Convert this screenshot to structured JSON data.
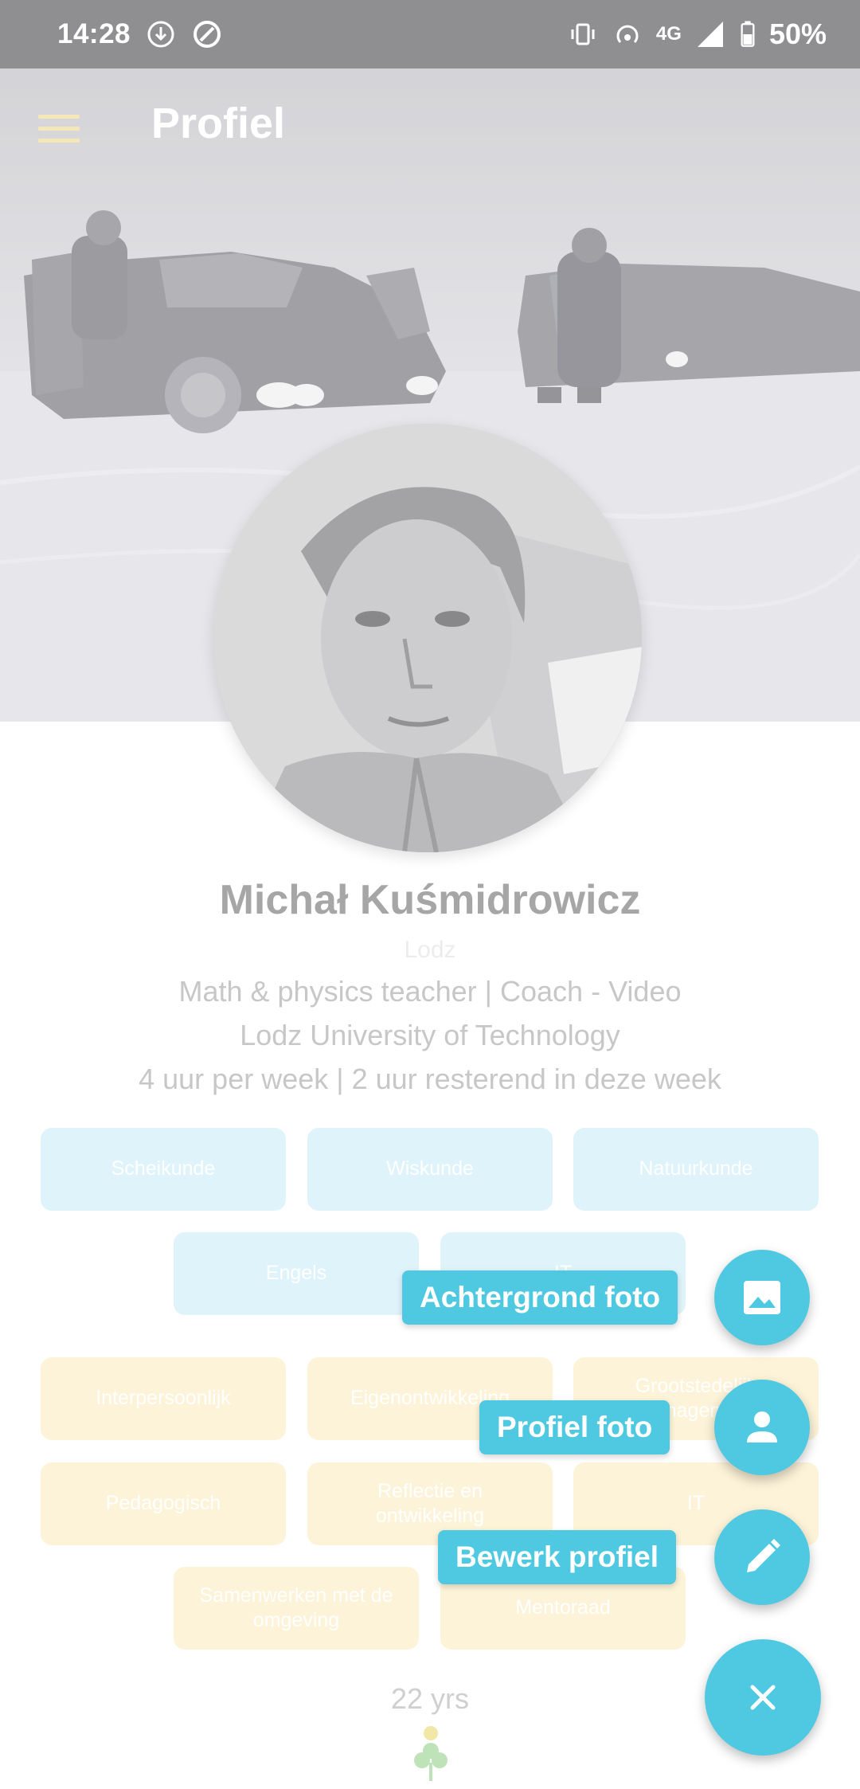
{
  "status_bar": {
    "time": "14:28",
    "network": "4G",
    "battery": "50%"
  },
  "header": {
    "title": "Profiel",
    "menu_icon": "hamburger-menu-icon"
  },
  "profile": {
    "name": "Michał Kuśmidrowicz",
    "location": "Lodz",
    "headline": "Math & physics teacher | Coach - Video",
    "university": "Lodz University of Technology",
    "hours": "4 uur per week | 2 uur resterend in deze week",
    "age": "22  yrs"
  },
  "subjects": [
    "Scheikunde",
    "Wiskunde",
    "Natuurkunde",
    "Engels",
    "IT"
  ],
  "skills": [
    "Interpersoonlijk",
    "Eigenontwikkeling",
    "Grootstedelijk\nmanagement",
    "Pedagogisch",
    "Reflectie en\nontwikkeling",
    "IT",
    "Samenwerken met de\nomgeving",
    "Mentoraad"
  ],
  "fab_menu": {
    "background_photo": "Achtergrond foto",
    "profile_photo": "Profiel foto",
    "edit_profile": "Bewerk profiel"
  },
  "colors": {
    "accent": "#4fc8e2",
    "subject_chip": "#dff3fa",
    "skill_chip": "#fdf3d8"
  }
}
